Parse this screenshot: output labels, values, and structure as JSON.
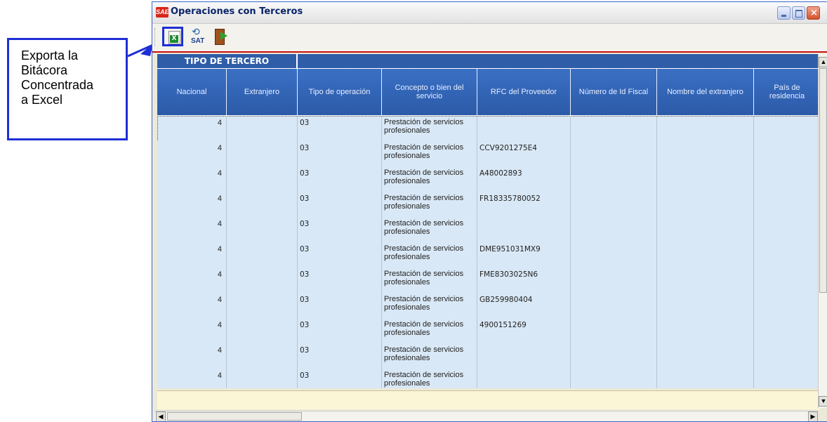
{
  "callout": {
    "text": "Exporta la\nBitácora\nConcentrada\na Excel",
    "color": "#1f2fd6"
  },
  "window": {
    "app_icon_text": "SAE",
    "title": "Operaciones con Terceros",
    "controls": {
      "minimize": "minimize-icon",
      "maximize": "maximize-icon",
      "close": "close-icon"
    }
  },
  "toolbar": {
    "items": [
      {
        "icon": "excel-export-icon"
      },
      {
        "icon": "sat-icon",
        "label": "SAT"
      },
      {
        "icon": "exit-door-icon"
      }
    ]
  },
  "grid": {
    "group_header": "TIPO DE TERCERO",
    "columns": [
      "Nacional",
      "Extranjero",
      "Tipo de operación",
      "Concepto o bien del servicio",
      "RFC del Proveedor",
      "Número de Id Fiscal",
      "Nombre del extranjero",
      "País de residencia"
    ],
    "rows": [
      {
        "nacional": "4",
        "extranjero": "",
        "tipo": "03",
        "concepto": "Prestación de servicios profesionales",
        "rfc": ""
      },
      {
        "nacional": "4",
        "extranjero": "",
        "tipo": "03",
        "concepto": "Prestación de servicios profesionales",
        "rfc": "CCV9201275E4"
      },
      {
        "nacional": "4",
        "extranjero": "",
        "tipo": "03",
        "concepto": "Prestación de servicios profesionales",
        "rfc": "A48002893"
      },
      {
        "nacional": "4",
        "extranjero": "",
        "tipo": "03",
        "concepto": "Prestación de servicios profesionales",
        "rfc": "FR18335780052"
      },
      {
        "nacional": "4",
        "extranjero": "",
        "tipo": "03",
        "concepto": "Prestación de servicios profesionales",
        "rfc": ""
      },
      {
        "nacional": "4",
        "extranjero": "",
        "tipo": "03",
        "concepto": "Prestación de servicios profesionales",
        "rfc": "DME951031MX9"
      },
      {
        "nacional": "4",
        "extranjero": "",
        "tipo": "03",
        "concepto": "Prestación de servicios profesionales",
        "rfc": "FME8303025N6"
      },
      {
        "nacional": "4",
        "extranjero": "",
        "tipo": "03",
        "concepto": "Prestación de servicios profesionales",
        "rfc": "GB259980404"
      },
      {
        "nacional": "4",
        "extranjero": "",
        "tipo": "03",
        "concepto": "Prestación de servicios profesionales",
        "rfc": "4900151269"
      },
      {
        "nacional": "4",
        "extranjero": "",
        "tipo": "03",
        "concepto": "Prestación de servicios profesionales",
        "rfc": ""
      },
      {
        "nacional": "4",
        "extranjero": "",
        "tipo": "03",
        "concepto": "Prestación de servicios profesionales",
        "rfc": ""
      }
    ]
  },
  "colors": {
    "header_blue": "#2f5da8",
    "row_fill": "#d9e8f6",
    "toolbar_accent": "#c81010",
    "footer_fill": "#fbf6d6"
  }
}
